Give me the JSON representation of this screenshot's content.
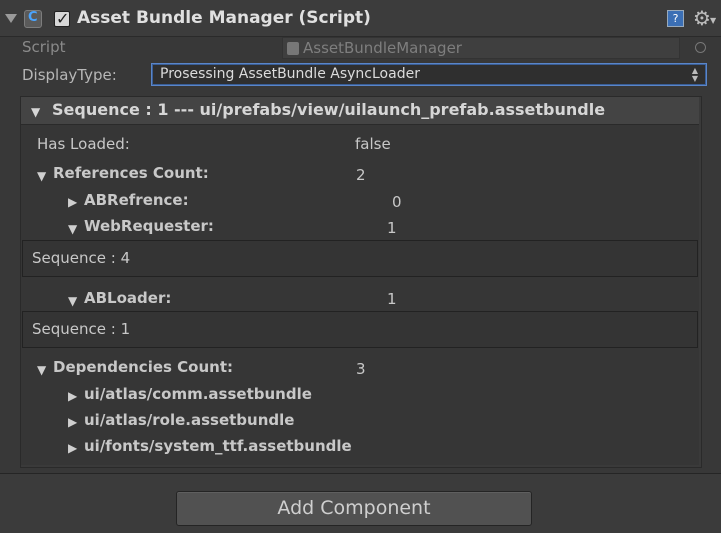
{
  "header": {
    "title": "Asset Bundle Manager (Script)",
    "enabled": true,
    "help_icon": "question-icon",
    "settings_icon": "gear-icon"
  },
  "script_field": {
    "label": "Script",
    "value": "AssetBundleManager"
  },
  "display_type": {
    "label": "DisplayType:",
    "value": "Prosessing AssetBundle AsyncLoader"
  },
  "sequence": {
    "title": "Sequence : 1 --- ui/prefabs/view/uilaunch_prefab.assetbundle",
    "has_loaded_label": "Has Loaded:",
    "has_loaded_value": "false",
    "references_label": "References Count:",
    "references_value": "2",
    "abrefrence_label": "ABRefrence:",
    "abrefrence_value": "0",
    "webrequester_label": "WebRequester:",
    "webrequester_value": "1",
    "webrequester_box": "Sequence : 4",
    "abloader_label": "ABLoader:",
    "abloader_value": "1",
    "abloader_box": "Sequence : 1",
    "dependencies_label": "Dependencies Count:",
    "dependencies_value": "3",
    "dependencies": [
      "ui/atlas/comm.assetbundle",
      "ui/atlas/role.assetbundle",
      "ui/fonts/system_ttf.assetbundle"
    ]
  },
  "footer": {
    "add_component_label": "Add Component"
  },
  "colors": {
    "background": "#383838",
    "dropdown_border": "#5a86c9",
    "text": "#c8c8c8"
  }
}
